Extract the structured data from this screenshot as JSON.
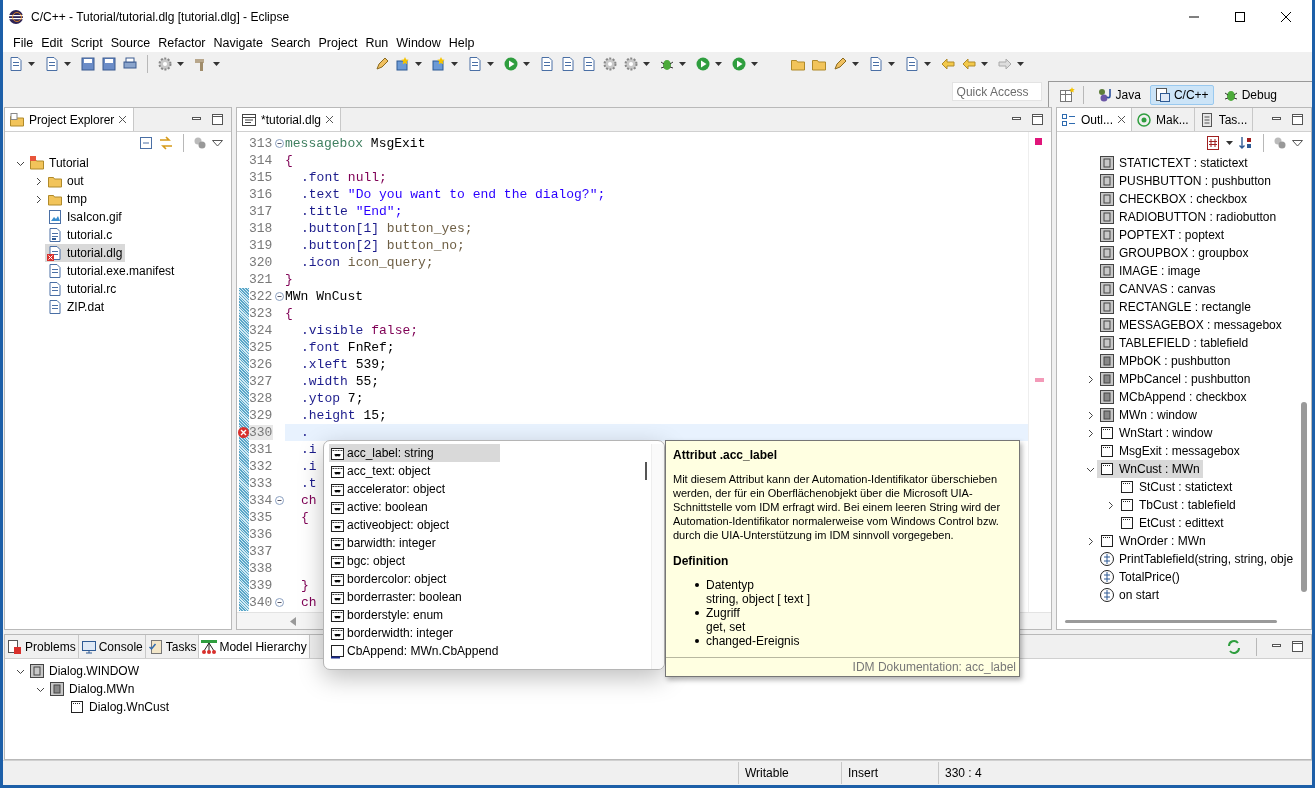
{
  "window": {
    "title": "C/C++ - Tutorial/tutorial.dlg [tutorial.dlg] - Eclipse"
  },
  "menu": [
    "File",
    "Edit",
    "Script",
    "Source",
    "Refactor",
    "Navigate",
    "Search",
    "Project",
    "Run",
    "Window",
    "Help"
  ],
  "quick_access": {
    "placeholder": "Quick Access"
  },
  "perspectives": [
    {
      "label": "Java",
      "kind": "java",
      "selected": false
    },
    {
      "label": "C/C++",
      "kind": "cpp",
      "selected": true
    },
    {
      "label": "Debug",
      "kind": "debug",
      "selected": false
    }
  ],
  "project_explorer": {
    "tab": "Project Explorer",
    "tree": [
      {
        "label": "Tutorial",
        "kind": "project",
        "expanded": true,
        "selected": false,
        "children": [
          {
            "label": "out",
            "kind": "folder",
            "expanded": false,
            "selected": false
          },
          {
            "label": "tmp",
            "kind": "folder",
            "expanded": false,
            "selected": false
          },
          {
            "label": "IsaIcon.gif",
            "kind": "image",
            "selected": false
          },
          {
            "label": "tutorial.c",
            "kind": "c",
            "selected": false
          },
          {
            "label": "tutorial.dlg",
            "kind": "dlg",
            "error": true,
            "selected": true
          },
          {
            "label": "tutorial.exe.manifest",
            "kind": "file",
            "selected": false
          },
          {
            "label": "tutorial.rc",
            "kind": "file",
            "selected": false
          },
          {
            "label": "ZIP.dat",
            "kind": "file",
            "selected": false
          }
        ]
      }
    ]
  },
  "editor": {
    "tab": "*tutorial.dlg",
    "lines": [
      {
        "num": "313",
        "fold": true,
        "tokens": [
          {
            "kind": "keyword",
            "text": "messagebox"
          },
          {
            "kind": "plain",
            "text": "MsgExit"
          }
        ]
      },
      {
        "num": "314",
        "tokens": [
          {
            "kind": "punct",
            "text": "{"
          }
        ]
      },
      {
        "num": "315",
        "indented": true,
        "tokens": [
          {
            "kind": "prop",
            "text": ".font"
          },
          {
            "kind": "value",
            "text": "null;"
          }
        ]
      },
      {
        "num": "316",
        "indented": true,
        "tokens": [
          {
            "kind": "prop",
            "text": ".text"
          },
          {
            "kind": "string",
            "text": "\"Do you want to end the dialog?\";"
          }
        ]
      },
      {
        "num": "317",
        "indented": true,
        "tokens": [
          {
            "kind": "prop",
            "text": ".title"
          },
          {
            "kind": "string",
            "text": "\"End\";"
          }
        ]
      },
      {
        "num": "318",
        "indented": true,
        "tokens": [
          {
            "kind": "prop",
            "text": ".button[1]"
          },
          {
            "kind": "ident",
            "text": "button_yes;"
          }
        ]
      },
      {
        "num": "319",
        "indented": true,
        "tokens": [
          {
            "kind": "prop",
            "text": ".button[2]"
          },
          {
            "kind": "ident",
            "text": "button_no;"
          }
        ]
      },
      {
        "num": "320",
        "indented": true,
        "tokens": [
          {
            "kind": "prop",
            "text": ".icon"
          },
          {
            "kind": "ident",
            "text": "icon_query;"
          }
        ]
      },
      {
        "num": "321",
        "tokens": [
          {
            "kind": "punct",
            "text": "}"
          }
        ]
      },
      {
        "num": "322",
        "fold": true,
        "changed": true,
        "tokens": [
          {
            "kind": "plain",
            "text": "MWn WnCust"
          }
        ]
      },
      {
        "num": "323",
        "changed": true,
        "tokens": [
          {
            "kind": "punct",
            "text": "{"
          }
        ]
      },
      {
        "num": "324",
        "changed": true,
        "indented": true,
        "tokens": [
          {
            "kind": "prop",
            "text": ".visible"
          },
          {
            "kind": "value",
            "text": "false;"
          }
        ]
      },
      {
        "num": "325",
        "changed": true,
        "indented": true,
        "tokens": [
          {
            "kind": "prop",
            "text": ".font"
          },
          {
            "kind": "plain",
            "text": "FnRef;"
          }
        ]
      },
      {
        "num": "326",
        "changed": true,
        "indented": true,
        "tokens": [
          {
            "kind": "prop",
            "text": ".xleft"
          },
          {
            "kind": "plain",
            "text": "539;"
          }
        ]
      },
      {
        "num": "327",
        "changed": true,
        "indented": true,
        "tokens": [
          {
            "kind": "prop",
            "text": ".width"
          },
          {
            "kind": "plain",
            "text": "55;"
          }
        ]
      },
      {
        "num": "328",
        "changed": true,
        "indented": true,
        "tokens": [
          {
            "kind": "prop",
            "text": ".ytop"
          },
          {
            "kind": "plain",
            "text": "7;"
          }
        ]
      },
      {
        "num": "329",
        "changed": true,
        "indented": true,
        "tokens": [
          {
            "kind": "prop",
            "text": ".height"
          },
          {
            "kind": "plain",
            "text": "15;"
          }
        ]
      },
      {
        "num": "330",
        "changed": true,
        "error": true,
        "current": true,
        "indented": true,
        "tokens": [
          {
            "kind": "prop",
            "text": "."
          }
        ]
      },
      {
        "num": "331",
        "changed": true,
        "indented": true,
        "tokens": [
          {
            "kind": "prop",
            "text": ".i"
          }
        ]
      },
      {
        "num": "332",
        "changed": true,
        "indented": true,
        "tokens": [
          {
            "kind": "prop",
            "text": ".i"
          }
        ]
      },
      {
        "num": "333",
        "changed": true,
        "indented": true,
        "tokens": [
          {
            "kind": "prop",
            "text": ".t"
          }
        ]
      },
      {
        "num": "334",
        "fold": true,
        "changed": true,
        "indented": true,
        "tokens": [
          {
            "kind": "value",
            "text": "ch"
          }
        ]
      },
      {
        "num": "335",
        "changed": true,
        "indented": true,
        "tokens": [
          {
            "kind": "punct",
            "text": "{"
          }
        ]
      },
      {
        "num": "336",
        "changed": true
      },
      {
        "num": "337",
        "changed": true
      },
      {
        "num": "338",
        "changed": true
      },
      {
        "num": "339",
        "changed": true,
        "indented": true,
        "tokens": [
          {
            "kind": "punct",
            "text": "}"
          }
        ]
      },
      {
        "num": "340",
        "fold": true,
        "changed": true,
        "indented": true,
        "tokens": [
          {
            "kind": "value",
            "text": "ch"
          }
        ]
      }
    ]
  },
  "outline": {
    "tabs": [
      {
        "label": "Outl...",
        "kind": "outline",
        "selected": true
      },
      {
        "label": "Mak...",
        "kind": "make",
        "selected": false
      },
      {
        "label": "Tas...",
        "kind": "tasks",
        "selected": false
      }
    ],
    "items": [
      {
        "label": "STATICTEXT : statictext",
        "kind": "default",
        "selected": false
      },
      {
        "label": "PUSHBUTTON : pushbutton",
        "kind": "default",
        "selected": false
      },
      {
        "label": "CHECKBOX : checkbox",
        "kind": "default",
        "selected": false
      },
      {
        "label": "RADIOBUTTON : radiobutton",
        "kind": "default",
        "selected": false
      },
      {
        "label": "POPTEXT : poptext",
        "kind": "default",
        "selected": false
      },
      {
        "label": "GROUPBOX : groupbox",
        "kind": "default",
        "selected": false
      },
      {
        "label": "IMAGE : image",
        "kind": "default",
        "selected": false
      },
      {
        "label": "CANVAS : canvas",
        "kind": "default",
        "selected": false
      },
      {
        "label": "RECTANGLE : rectangle",
        "kind": "default",
        "selected": false
      },
      {
        "label": "MESSAGEBOX : messagebox",
        "kind": "default",
        "selected": false
      },
      {
        "label": "TABLEFIELD : tablefield",
        "kind": "default",
        "selected": false
      },
      {
        "label": "MPbOK : pushbutton",
        "kind": "model",
        "selected": false
      },
      {
        "label": "MPbCancel : pushbutton",
        "kind": "model",
        "expanded": false,
        "selected": false
      },
      {
        "label": "MCbAppend : checkbox",
        "kind": "model",
        "selected": false
      },
      {
        "label": "MWn : window",
        "kind": "model",
        "expanded": false,
        "selected": false
      },
      {
        "label": "WnStart : window",
        "kind": "instance",
        "expanded": false,
        "selected": false
      },
      {
        "label": "MsgExit : messagebox",
        "kind": "instance",
        "selected": false
      },
      {
        "label": "WnCust : MWn",
        "kind": "instance",
        "expanded": true,
        "selected": true,
        "children": [
          {
            "label": "StCust : statictext",
            "kind": "instance",
            "selected": false
          },
          {
            "label": "TbCust : tablefield",
            "kind": "instance",
            "expanded": false,
            "selected": false
          },
          {
            "label": "EtCust : edittext",
            "kind": "instance",
            "selected": false
          }
        ]
      },
      {
        "label": "WnOrder : MWn",
        "kind": "instance",
        "expanded": false,
        "selected": false
      },
      {
        "label": "PrintTablefield(string, string, obje",
        "kind": "function",
        "selected": false
      },
      {
        "label": "TotalPrice()",
        "kind": "function",
        "selected": false
      },
      {
        "label": "on start",
        "kind": "function",
        "selected": false
      }
    ]
  },
  "bottom_panel": {
    "tabs": [
      {
        "label": "Problems",
        "kind": "problems",
        "selected": false
      },
      {
        "label": "Console",
        "kind": "console",
        "selected": false
      },
      {
        "label": "Tasks",
        "kind": "tasks",
        "selected": false
      },
      {
        "label": "Model Hierarchy",
        "kind": "hierarchy",
        "selected": true
      }
    ],
    "tree": [
      {
        "label": "Dialog.WINDOW",
        "kind": "default",
        "expanded": true,
        "children": [
          {
            "label": "Dialog.MWn",
            "kind": "model",
            "expanded": true,
            "children": [
              {
                "label": "Dialog.WnCust",
                "kind": "instance"
              }
            ]
          }
        ]
      }
    ]
  },
  "completion": {
    "items": [
      {
        "label": "acc_label: string",
        "kind": "attribute",
        "selected": true
      },
      {
        "label": "acc_text: object",
        "kind": "attribute",
        "selected": false
      },
      {
        "label": "accelerator: object",
        "kind": "attribute",
        "selected": false
      },
      {
        "label": "active: boolean",
        "kind": "attribute",
        "selected": false
      },
      {
        "label": "activeobject: object",
        "kind": "attribute",
        "selected": false
      },
      {
        "label": "barwidth: integer",
        "kind": "attribute",
        "selected": false
      },
      {
        "label": "bgc: object",
        "kind": "attribute",
        "selected": false
      },
      {
        "label": "bordercolor: object",
        "kind": "attribute",
        "selected": false
      },
      {
        "label": "borderraster: boolean",
        "kind": "attribute",
        "selected": false
      },
      {
        "label": "borderstyle: enum",
        "kind": "attribute",
        "selected": false
      },
      {
        "label": "borderwidth: integer",
        "kind": "attribute",
        "selected": false
      },
      {
        "label": "CbAppend: MWn.CbAppend",
        "kind": "child",
        "selected": false
      }
    ]
  },
  "documentation": {
    "title": "Attribut .acc_label",
    "text": "Mit diesem Attribut kann der Automation-Identifikator überschieben werden, der für ein Oberflächenobjekt über die Microsoft UIA-Schnittstelle vom IDM erfragt wird. Bei einem leeren String wird der Automation-Identifikator normalerweise vom Windows Control bzw. durch die UIA-Unterstützung im IDM sinnvoll vorgegeben.",
    "heading": "Definition",
    "bullets": [
      {
        "term": "Datentyp",
        "detail": "string, object [ text ]"
      },
      {
        "term": "Zugriff",
        "detail": "get, set"
      },
      {
        "term": "changed-Ereignis"
      }
    ],
    "footer": "IDM Dokumentation: acc_label"
  },
  "status_bar": [
    "Writable",
    "Insert",
    "330 : 4"
  ]
}
